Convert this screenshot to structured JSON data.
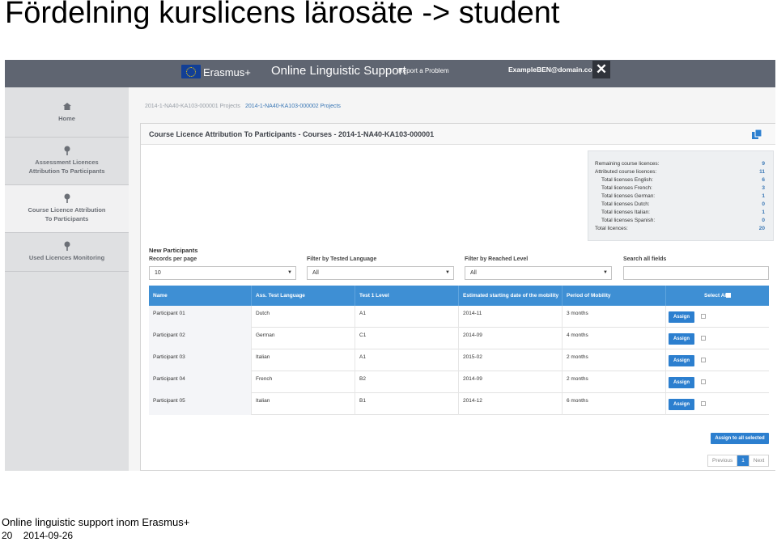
{
  "slide": {
    "title": "Fördelning kurslicens lärosäte -> student",
    "footer_text": "Online linguistic support inom Erasmus+",
    "page_number": "20",
    "date": "2014-09-26"
  },
  "header": {
    "brand": "Erasmus+",
    "app_name": "Online Linguistic Support",
    "report_link": "Report a Problem",
    "user_email": "ExampleBEN@domain.com",
    "close_icon": "close-icon"
  },
  "sidebar": {
    "items": [
      {
        "label": "Home",
        "icon": "home-icon"
      },
      {
        "label": "Assessment Licences Attribution To Participants",
        "icon": "pin-icon"
      },
      {
        "label": "Course Licence Attribution To Participants",
        "icon": "pin-icon",
        "active": true
      },
      {
        "label": "Used Licences Monitoring",
        "icon": "pin-icon"
      }
    ]
  },
  "tabs": [
    {
      "label": "2014-1-NA40-KA103-000001 Projects"
    },
    {
      "label": "2014-1-NA40-KA103-000002 Projects"
    }
  ],
  "panel": {
    "title": "Course Licence Attribution To Participants - Courses - 2014-1-NA40-KA103-000001"
  },
  "stats": [
    {
      "label": "Remaining course licences:",
      "value": "9"
    },
    {
      "label": "Attributed course licences:",
      "value": "11"
    },
    {
      "label": "Total licenses English:",
      "value": "6"
    },
    {
      "label": "Total licenses French:",
      "value": "3"
    },
    {
      "label": "Total licenses German:",
      "value": "1"
    },
    {
      "label": "Total licenses Dutch:",
      "value": "0"
    },
    {
      "label": "Total licenses Italian:",
      "value": "1"
    },
    {
      "label": "Total licenses Spanish:",
      "value": "0"
    },
    {
      "label": "Total licences:",
      "value": "20"
    }
  ],
  "filters": {
    "section_title": "New Participants",
    "records_label": "Records per page",
    "records_value": "10",
    "tested_label": "Filter by Tested Language",
    "tested_value": "All",
    "reached_label": "Filter by Reached Level",
    "reached_value": "All",
    "search_label": "Search all fields"
  },
  "table": {
    "headers": [
      "Name",
      "Ass. Test Language",
      "Test 1 Level",
      "Estimated starting date of the mobility",
      "Period of Mobility",
      "Select All"
    ],
    "rows": [
      {
        "name": "Participant 01",
        "language": "Dutch",
        "level": "A1",
        "start": "2014-11",
        "period": "3 months"
      },
      {
        "name": "Participant 02",
        "language": "German",
        "level": "C1",
        "start": "2014-09",
        "period": "4 months"
      },
      {
        "name": "Participant 03",
        "language": "Italian",
        "level": "A1",
        "start": "2015-02",
        "period": "2 months"
      },
      {
        "name": "Participant 04",
        "language": "French",
        "level": "B2",
        "start": "2014-09",
        "period": "2 months"
      },
      {
        "name": "Participant 05",
        "language": "Italian",
        "level": "B1",
        "start": "2014-12",
        "period": "6 months"
      }
    ],
    "assign_label": "Assign",
    "assign_all_label": "Assign to all selected"
  },
  "pager": {
    "previous": "Previous",
    "current": "1",
    "next": "Next"
  },
  "colors": {
    "accent": "#2c7fcf",
    "table_header": "#3e8fd4",
    "topbar": "#5f6571"
  }
}
